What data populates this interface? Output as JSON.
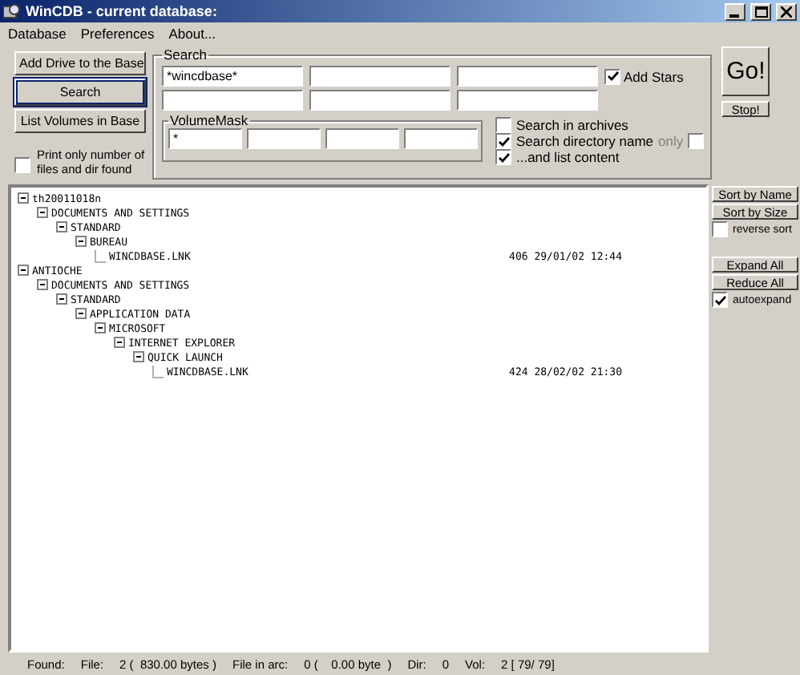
{
  "window": {
    "title": "WinCDB - current database:"
  },
  "menu": [
    "Database",
    "Preferences",
    "About..."
  ],
  "left_buttons": [
    {
      "label": "Add Drive to the Base",
      "focused": false
    },
    {
      "label": "Search",
      "focused": true
    },
    {
      "label": "List Volumes in Base",
      "focused": false
    }
  ],
  "print_only": {
    "label": "Print only number of files and dir found",
    "checked": false
  },
  "search": {
    "title": "Search",
    "fields": [
      {
        "kind": "text",
        "value": "*wincdbase*"
      },
      {
        "kind": "text"
      },
      {
        "kind": "text"
      },
      {
        "kind": "text"
      },
      {
        "kind": "text"
      },
      {
        "kind": "text"
      }
    ],
    "add_stars": {
      "label": "Add Stars",
      "checked": true
    },
    "volume_mask": {
      "title": "VolumeMask",
      "fields": [
        {
          "kind": "text",
          "value": "*"
        },
        {
          "kind": "text"
        },
        {
          "kind": "text"
        },
        {
          "kind": "text"
        }
      ]
    },
    "options": [
      {
        "label": "Search in archives",
        "checked": false
      },
      {
        "label": "Search directory name",
        "checked": true,
        "only_label": "only",
        "only_checked": false
      },
      {
        "label": "...and list content",
        "checked": true
      }
    ]
  },
  "go_button": "Go!",
  "stop_button": "Stop!",
  "tree": [
    {
      "label": "th20011018n",
      "expanded": true,
      "children": [
        {
          "label": "DOCUMENTS AND SETTINGS",
          "expanded": true,
          "children": [
            {
              "label": "STANDARD",
              "expanded": true,
              "children": [
                {
                  "label": "BUREAU",
                  "expanded": true,
                  "children": [
                    {
                      "label": "WINCDBASE.LNK",
                      "info": "406 29/01/02 12:44"
                    }
                  ]
                }
              ]
            }
          ]
        }
      ]
    },
    {
      "label": "ANTIOCHE",
      "expanded": true,
      "children": [
        {
          "label": "DOCUMENTS AND SETTINGS",
          "expanded": true,
          "children": [
            {
              "label": "STANDARD",
              "expanded": true,
              "children": [
                {
                  "label": "APPLICATION DATA",
                  "expanded": true,
                  "children": [
                    {
                      "label": "MICROSOFT",
                      "expanded": true,
                      "children": [
                        {
                          "label": "INTERNET EXPLORER",
                          "expanded": true,
                          "children": [
                            {
                              "label": "QUICK LAUNCH",
                              "expanded": true,
                              "children": [
                                {
                                  "label": "WINCDBASE.LNK",
                                  "info": "424 28/02/02 21:30"
                                }
                              ]
                            }
                          ]
                        }
                      ]
                    }
                  ]
                }
              ]
            }
          ]
        }
      ]
    }
  ],
  "side_panel": {
    "sort_buttons": [
      "Sort by Name",
      "Sort by Size"
    ],
    "reverse_sort": {
      "label": "reverse sort",
      "checked": false
    },
    "tree_buttons": [
      "Expand All",
      "Reduce All"
    ],
    "autoexpand": {
      "label": "autoexpand",
      "checked": true
    }
  },
  "status_bar": [
    "Found:",
    "File:",
    "2 (  830.00 bytes )",
    "File in arc:",
    "0 (    0.00 byte  )",
    "Dir:",
    "0",
    "Vol:",
    "2 [ 79/ 79]"
  ]
}
